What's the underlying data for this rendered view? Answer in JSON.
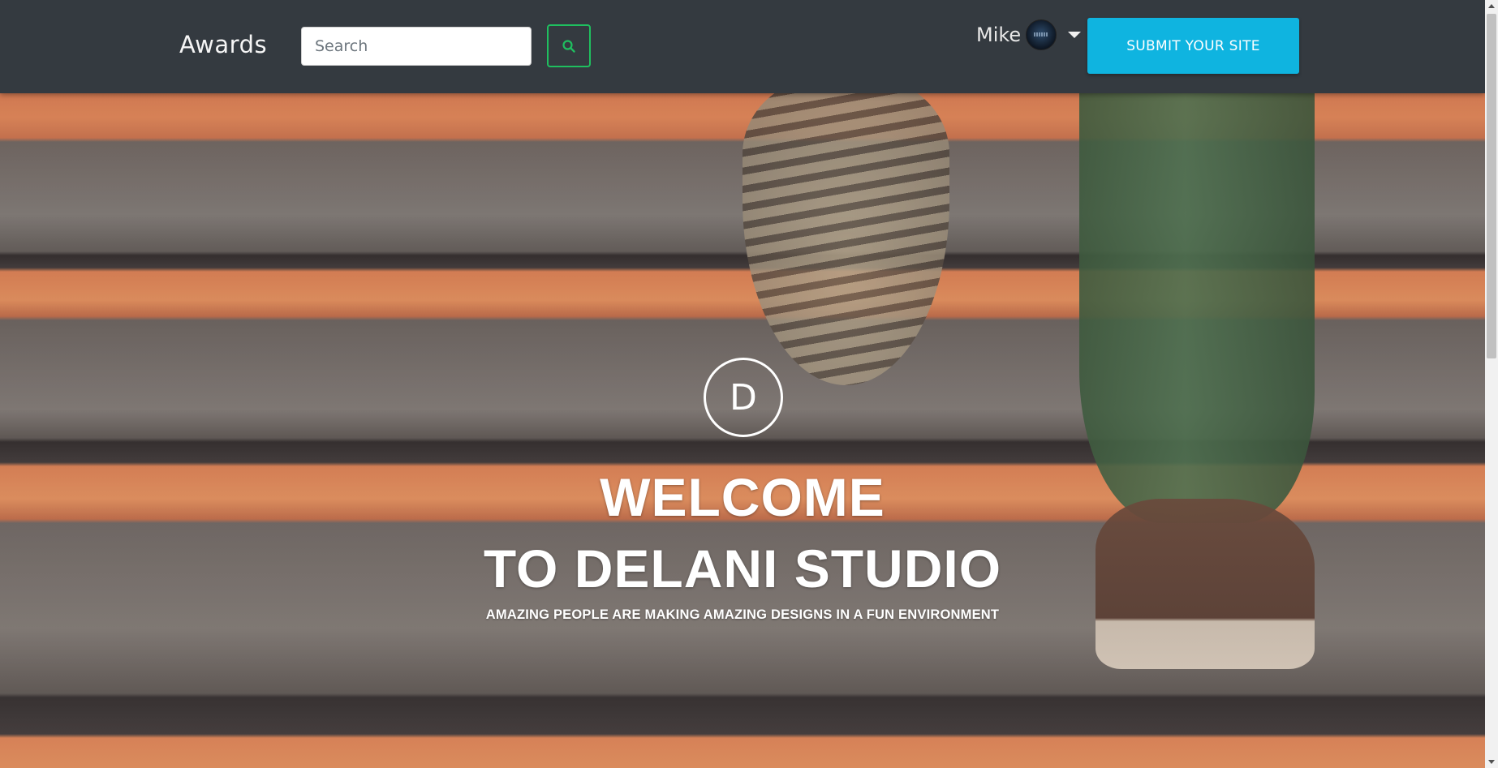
{
  "navbar": {
    "brand": "Awards",
    "search": {
      "placeholder": "Search",
      "value": ""
    },
    "search_button_icon": "search-icon",
    "user": {
      "name": "Mike",
      "avatar_icon": "avatar",
      "dropdown_icon": "caret-down-icon"
    },
    "submit_label": "SUBMIT YOUR SITE"
  },
  "hero": {
    "logo_letter": "D",
    "title_line_1": "WELCOME",
    "title_line_2": "TO DELANI STUDIO",
    "subtitle": "AMAZING PEOPLE ARE MAKING AMAZING DESIGNS IN A FUN ENVIRONMENT"
  },
  "colors": {
    "navbar_bg": "#343a40",
    "search_button_border": "#1fbf5f",
    "submit_button_bg": "#0fb4e0",
    "hero_stripe_orange": "#f39c68",
    "hero_stripe_gray": "#8c8480"
  }
}
